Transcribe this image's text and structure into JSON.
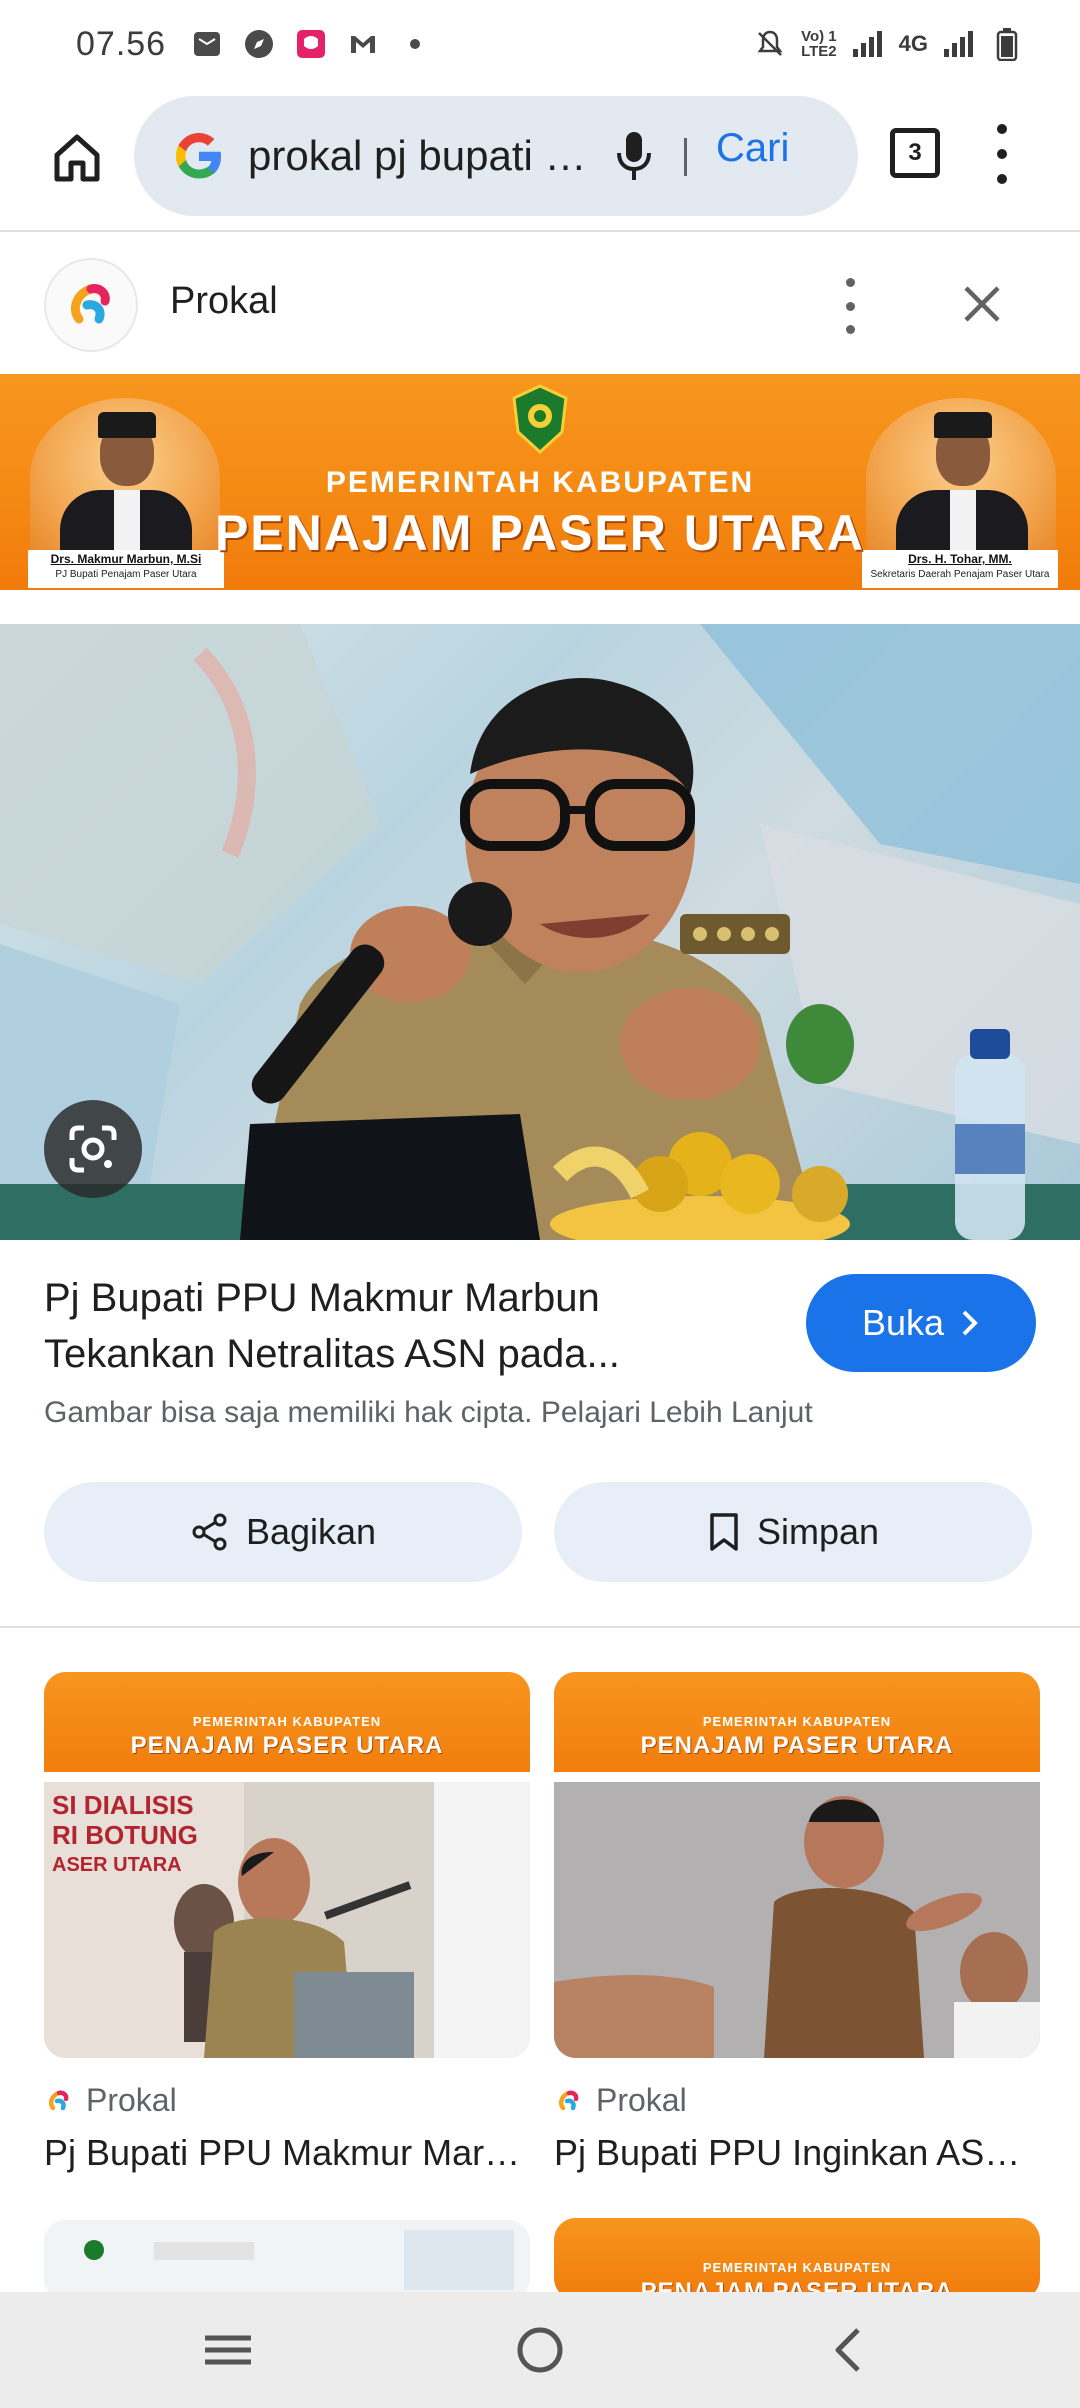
{
  "status_bar": {
    "time": "07.56",
    "network_label": "4G",
    "volte_label": "Vo) 1\nLTE2"
  },
  "omnibox": {
    "query": "prokal pj bupati ppu makmur marbun",
    "search_label": "Cari",
    "tab_count": "3"
  },
  "source": {
    "name": "Prokal"
  },
  "banner": {
    "subtitle": "PEMERINTAH KABUPATEN",
    "title": "PENAJAM PASER UTARA",
    "left_name": "Drs. Makmur Marbun, M.Si",
    "left_role": "PJ Bupati Penajam Paser Utara",
    "right_name": "Drs. H. Tohar, MM.",
    "right_role": "Sekretaris Daerah Penajam Paser Utara"
  },
  "result": {
    "title_line1": "Pj Bupati PPU Makmur Marbun",
    "title_line2": "Tekankan Netralitas ASN pada...",
    "open_label": "Buka",
    "copyright_text": "Gambar bisa saja memiliki hak cipta. Pelajari Lebih Lanjut",
    "share_label": "Bagikan",
    "save_label": "Simpan"
  },
  "related": [
    {
      "source": "Prokal",
      "title": "Pj Bupati PPU Makmur Marbun Tekankan",
      "banner_subtitle": "PEMERINTAH KABUPATEN",
      "banner_title": "PENAJAM PASER UTARA",
      "overlay_text_1": "SI DIALISIS",
      "overlay_text_2": "RI BOTUNG",
      "overlay_text_3": "ASER UTARA"
    },
    {
      "source": "Prokal",
      "title": "Pj Bupati PPU Inginkan ASN Netral",
      "banner_subtitle": "PEMERINTAH KABUPATEN",
      "banner_title": "PENAJAM PASER UTARA"
    },
    {
      "banner_subtitle": "",
      "banner_title": ""
    },
    {
      "banner_subtitle": "PEMERINTAH KABUPATEN",
      "banner_title": "PENAJAM PASER UTARA"
    }
  ],
  "colors": {
    "accent": "#1a73e8",
    "banner_orange": "#f58a13",
    "omnibox_bg": "#e3e9f1",
    "action_bg": "#e8eef7"
  },
  "icons": {
    "home": "home-icon",
    "mic": "mic-icon",
    "more": "more-vert-icon",
    "close": "close-icon",
    "lens": "google-lens-icon",
    "share": "share-icon",
    "bookmark": "bookmark-icon",
    "chevron": "chevron-right-icon"
  }
}
